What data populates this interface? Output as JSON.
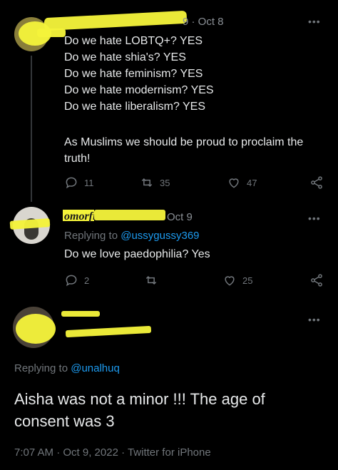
{
  "tweets": [
    {
      "date": "9 · Oct 8",
      "lines": [
        "Do we hate LOBTQ+? YES",
        "Do we hate shia's? YES",
        "Do we hate feminism? YES",
        "Do we hate modernism? YES",
        "Do we hate liberalism? YES",
        "",
        "As Muslims we should be proud to proclaim the",
        "truth!"
      ],
      "replies": "11",
      "retweets": "35",
      "likes": "47"
    },
    {
      "name": "omorfi",
      "date": "Oct 9",
      "replying_label": "Replying to ",
      "replying_handle": "@ussygussy369",
      "text": "Do we love paedophilia? Yes",
      "replies": "2",
      "likes": "25"
    },
    {
      "replying_label": "Replying to ",
      "replying_handle": "@unalhuq",
      "text_line1": "Aisha was not a minor !!! The age of",
      "text_line2": "consent was 3",
      "timestamp": "7:07 AM · Oct 9, 2022 · Twitter for iPhone"
    }
  ],
  "icons": {
    "more": "more-icon",
    "reply": "reply-icon",
    "retweet": "retweet-icon",
    "like": "like-icon",
    "share": "share-icon"
  },
  "colors": {
    "background": "#000000",
    "text": "#e7e9ea",
    "muted": "#71767b",
    "link": "#1d9bf0",
    "redaction": "#f4f33a"
  }
}
